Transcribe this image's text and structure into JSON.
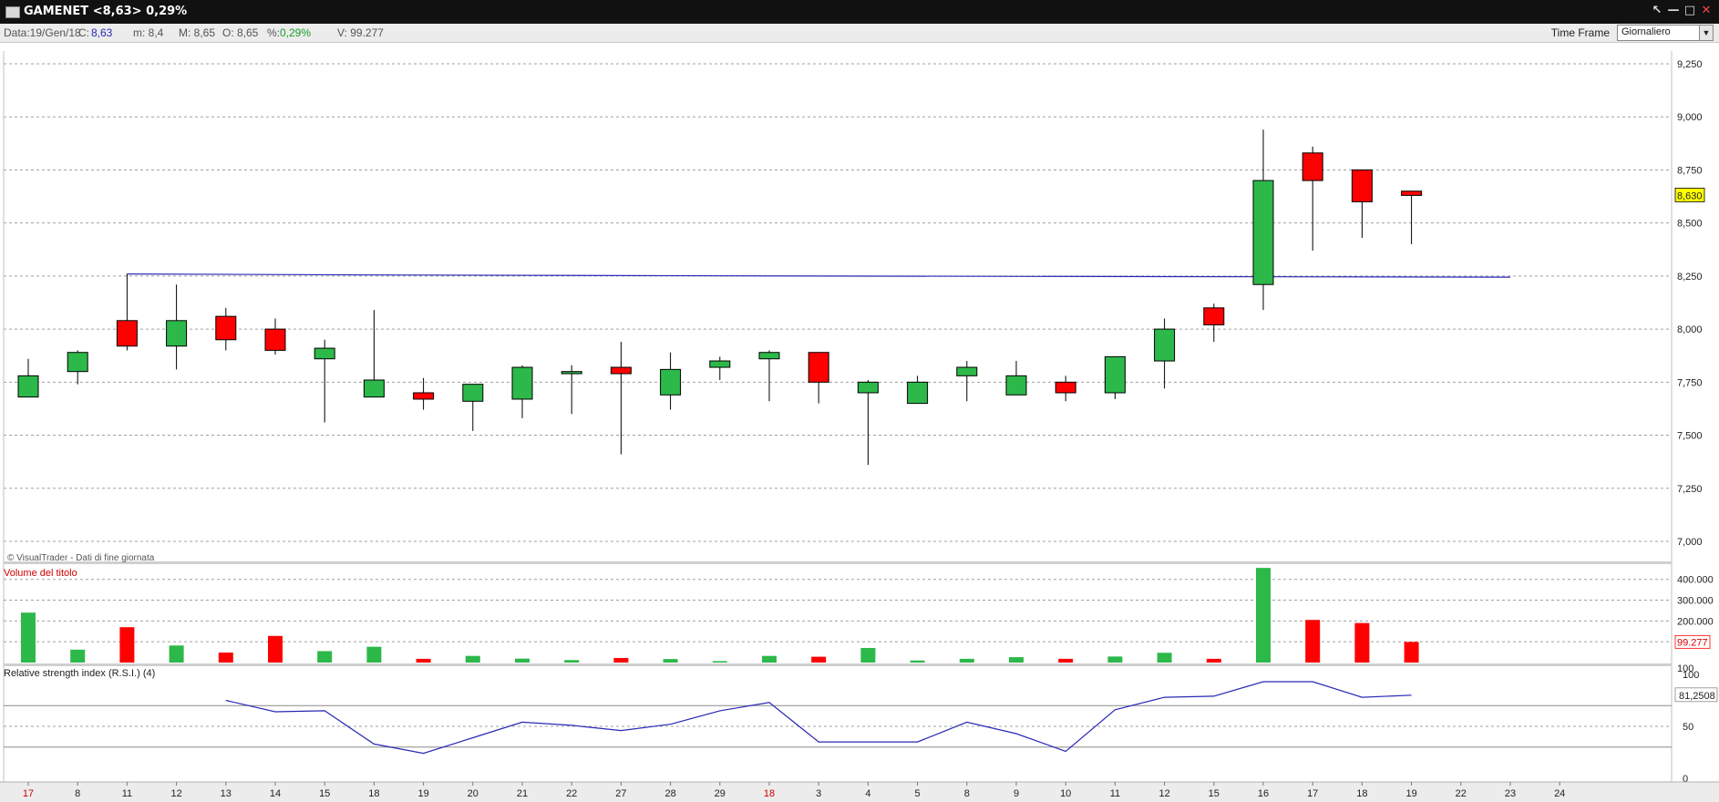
{
  "window": {
    "title": "GAMENET <8,63> 0,29%",
    "controls": [
      "↖",
      "—",
      "□",
      "✕"
    ]
  },
  "infobar": {
    "date": "Data:19/Gen/18",
    "close_label": "C:",
    "close": "8,63",
    "min": "m: 8,4",
    "max": "M: 8,65",
    "open": "O: 8,65",
    "pct_label": "%:",
    "pct": "0,29%",
    "volume": "V: 99.277",
    "timeframe_label": "Time Frame",
    "timeframe_value": "Giornaliero"
  },
  "colors": {
    "up": "#2db84a",
    "down": "#ff0000",
    "line": "#2828b4",
    "grid": "#a0a0a0",
    "price_badge": "#ffff00"
  },
  "watermark": "© VisualTrader - Dati di fine giornata",
  "chart_data": [
    {
      "type": "candlestick",
      "title": "",
      "price_label": "8,630",
      "ylim": [
        7.0,
        9.25
      ],
      "yticks": [
        "7,000",
        "7,250",
        "7,500",
        "7,750",
        "8,000",
        "8,250",
        "8,500",
        "8,750",
        "9,000",
        "9,250"
      ],
      "ytick_values": [
        7.0,
        7.25,
        7.5,
        7.75,
        8.0,
        8.25,
        8.5,
        8.75,
        9.0,
        9.25
      ],
      "x_labels": [
        "17",
        "8",
        "11",
        "12",
        "13",
        "14",
        "15",
        "18",
        "19",
        "20",
        "21",
        "22",
        "27",
        "28",
        "29",
        "18",
        "3",
        "4",
        "5",
        "8",
        "9",
        "10",
        "11",
        "12",
        "15",
        "16",
        "17",
        "18",
        "19",
        "22",
        "23",
        "24"
      ],
      "x_label_colors": [
        "red",
        "",
        "",
        "",
        "",
        "",
        "",
        "",
        "",
        "",
        "",
        "",
        "",
        "",
        "",
        "red",
        "",
        "",
        "",
        "",
        "",
        "",
        "",
        "",
        "",
        "",
        "",
        "",
        "",
        "",
        "",
        ""
      ],
      "candles": [
        {
          "o": 7.68,
          "h": 7.86,
          "l": 7.68,
          "c": 7.78
        },
        {
          "o": 7.8,
          "h": 7.9,
          "l": 7.74,
          "c": 7.89
        },
        {
          "o": 8.04,
          "h": 8.26,
          "l": 7.9,
          "c": 7.92
        },
        {
          "o": 7.92,
          "h": 8.21,
          "l": 7.81,
          "c": 8.04
        },
        {
          "o": 8.06,
          "h": 8.1,
          "l": 7.9,
          "c": 7.95
        },
        {
          "o": 8.0,
          "h": 8.05,
          "l": 7.88,
          "c": 7.9
        },
        {
          "o": 7.86,
          "h": 7.95,
          "l": 7.56,
          "c": 7.91
        },
        {
          "o": 7.68,
          "h": 8.09,
          "l": 7.68,
          "c": 7.76
        },
        {
          "o": 7.7,
          "h": 7.77,
          "l": 7.62,
          "c": 7.67
        },
        {
          "o": 7.66,
          "h": 7.74,
          "l": 7.52,
          "c": 7.74
        },
        {
          "o": 7.67,
          "h": 7.83,
          "l": 7.58,
          "c": 7.82
        },
        {
          "o": 7.79,
          "h": 7.83,
          "l": 7.6,
          "c": 7.8
        },
        {
          "o": 7.82,
          "h": 7.94,
          "l": 7.41,
          "c": 7.79
        },
        {
          "o": 7.69,
          "h": 7.89,
          "l": 7.62,
          "c": 7.81
        },
        {
          "o": 7.82,
          "h": 7.87,
          "l": 7.76,
          "c": 7.85
        },
        {
          "o": 7.86,
          "h": 7.9,
          "l": 7.66,
          "c": 7.89
        },
        {
          "o": 7.89,
          "h": 7.89,
          "l": 7.65,
          "c": 7.75
        },
        {
          "o": 7.7,
          "h": 7.76,
          "l": 7.36,
          "c": 7.75
        },
        {
          "o": 7.65,
          "h": 7.78,
          "l": 7.65,
          "c": 7.75
        },
        {
          "o": 7.78,
          "h": 7.85,
          "l": 7.66,
          "c": 7.82
        },
        {
          "o": 7.69,
          "h": 7.85,
          "l": 7.69,
          "c": 7.78
        },
        {
          "o": 7.75,
          "h": 7.78,
          "l": 7.66,
          "c": 7.7
        },
        {
          "o": 7.7,
          "h": 7.87,
          "l": 7.67,
          "c": 7.87
        },
        {
          "o": 7.85,
          "h": 8.05,
          "l": 7.72,
          "c": 8.0
        },
        {
          "o": 8.1,
          "h": 8.12,
          "l": 7.94,
          "c": 8.02
        },
        {
          "o": 8.21,
          "h": 8.94,
          "l": 8.09,
          "c": 8.7
        },
        {
          "o": 8.83,
          "h": 8.86,
          "l": 8.37,
          "c": 8.7
        },
        {
          "o": 8.75,
          "h": 8.75,
          "l": 8.43,
          "c": 8.6
        },
        {
          "o": 8.65,
          "h": 8.65,
          "l": 8.4,
          "c": 8.63
        }
      ],
      "reference_line": [
        [
          2,
          8.26
        ],
        [
          7,
          8.255
        ],
        [
          16,
          8.25
        ],
        [
          30,
          8.245
        ]
      ]
    },
    {
      "type": "bar",
      "title": "Volume del titolo",
      "value_label": "99.277",
      "yticks": [
        "100",
        "200.000",
        "300.000",
        "400.000"
      ],
      "ytick_values": [
        0,
        200000,
        300000,
        400000
      ],
      "ylim": [
        0,
        460000
      ],
      "values": [
        240000,
        62000,
        170000,
        82000,
        48000,
        128000,
        55000,
        76000,
        18000,
        32000,
        19000,
        12000,
        22000,
        17000,
        7000,
        32000,
        28000,
        70000,
        10000,
        18000,
        26000,
        18000,
        29000,
        47000,
        18000,
        455000,
        205000,
        190000,
        99277
      ],
      "directions": [
        "up",
        "up",
        "down",
        "up",
        "down",
        "down",
        "up",
        "up",
        "down",
        "up",
        "up",
        "up",
        "down",
        "up",
        "up",
        "up",
        "down",
        "up",
        "up",
        "up",
        "up",
        "down",
        "up",
        "up",
        "down",
        "up",
        "down",
        "down",
        "down"
      ]
    },
    {
      "type": "line",
      "title": "Relative strength index (R.S.I.) (4)",
      "value_label": "81,2508",
      "yticks": [
        "0",
        "50",
        "100"
      ],
      "ytick_values": [
        0,
        50,
        100
      ],
      "ylim": [
        0,
        100
      ],
      "bands": [
        30,
        70
      ],
      "start_index": 4,
      "values": [
        75,
        64,
        65,
        33,
        24,
        39,
        54,
        51,
        46,
        52,
        65,
        73,
        35,
        35,
        35,
        54,
        43,
        26,
        66,
        78,
        79,
        93,
        93,
        78,
        80
      ]
    }
  ]
}
